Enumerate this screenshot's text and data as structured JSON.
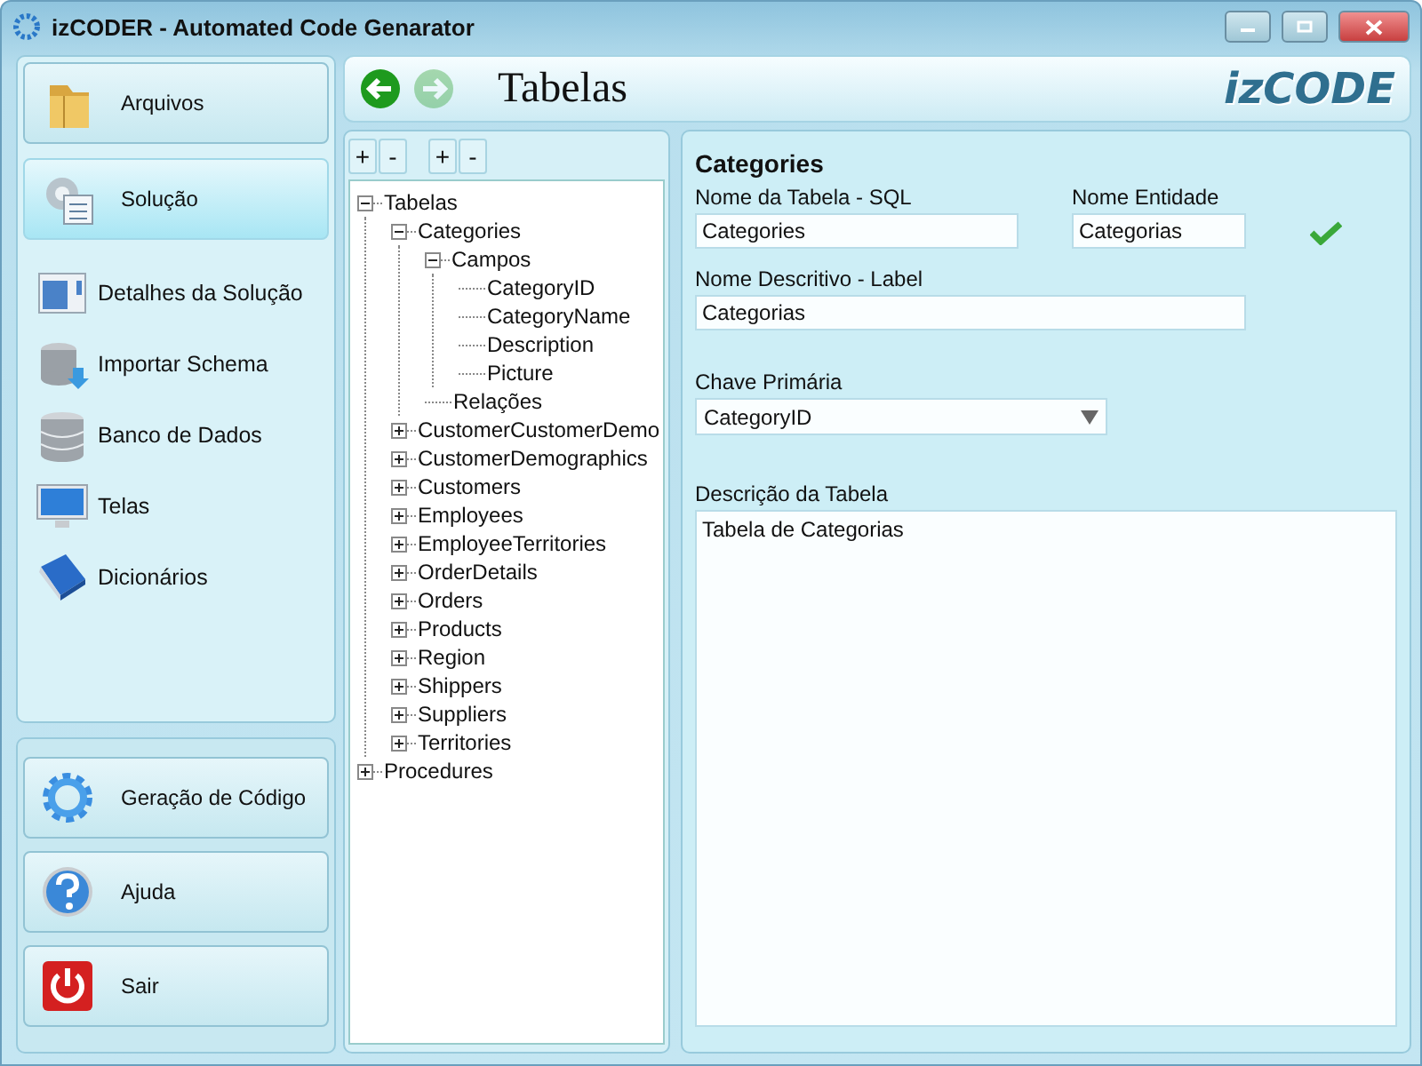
{
  "window": {
    "title": "izCODER - Automated Code Genarator"
  },
  "sidebar": {
    "sections": [
      {
        "label": "Arquivos",
        "kind": "folder",
        "selected": false
      },
      {
        "label": "Solução",
        "kind": "gears",
        "selected": true
      }
    ],
    "items": [
      {
        "label": "Detalhes da Solução",
        "kind": "details"
      },
      {
        "label": "Importar Schema",
        "kind": "import"
      },
      {
        "label": "Banco de Dados",
        "kind": "database"
      },
      {
        "label": "Telas",
        "kind": "monitor"
      },
      {
        "label": "Dicionários",
        "kind": "book"
      }
    ],
    "buttons": [
      {
        "label": "Geração de Código",
        "kind": "gear"
      },
      {
        "label": "Ajuda",
        "kind": "help"
      },
      {
        "label": "Sair",
        "kind": "power"
      }
    ]
  },
  "header": {
    "title": "Tabelas",
    "logo": "izCODE",
    "back_disabled": false,
    "forward_disabled": true
  },
  "tree_toolbar": [
    [
      "+",
      "-"
    ],
    [
      "+",
      "-"
    ]
  ],
  "tree": [
    {
      "label": "Tabelas",
      "expanded": true,
      "children": [
        {
          "label": "Categories",
          "expanded": true,
          "children": [
            {
              "label": "Campos",
              "expanded": true,
              "children": [
                {
                  "label": "CategoryID"
                },
                {
                  "label": "CategoryName"
                },
                {
                  "label": "Description"
                },
                {
                  "label": "Picture"
                }
              ]
            },
            {
              "label": "Relações"
            }
          ]
        },
        {
          "label": "CustomerCustomerDemo",
          "expanded": false
        },
        {
          "label": "CustomerDemographics",
          "expanded": false
        },
        {
          "label": "Customers",
          "expanded": false
        },
        {
          "label": "Employees",
          "expanded": false
        },
        {
          "label": "EmployeeTerritories",
          "expanded": false
        },
        {
          "label": "OrderDetails",
          "expanded": false
        },
        {
          "label": "Orders",
          "expanded": false
        },
        {
          "label": "Products",
          "expanded": false
        },
        {
          "label": "Region",
          "expanded": false
        },
        {
          "label": "Shippers",
          "expanded": false
        },
        {
          "label": "Suppliers",
          "expanded": false
        },
        {
          "label": "Territories",
          "expanded": false
        }
      ]
    },
    {
      "label": "Procedures",
      "expanded": false
    }
  ],
  "details": {
    "heading": "Categories",
    "table_name": {
      "label": "Nome da Tabela - SQL",
      "value": "Categories"
    },
    "entity_name": {
      "label": "Nome Entidade",
      "value": "Categorias",
      "valid": true
    },
    "display_name": {
      "label": "Nome Descritivo - Label",
      "value": "Categorias"
    },
    "primary_key": {
      "label": "Chave Primária",
      "value": "CategoryID"
    },
    "description": {
      "label": "Descrição da Tabela",
      "value": "Tabela de Categorias"
    }
  }
}
